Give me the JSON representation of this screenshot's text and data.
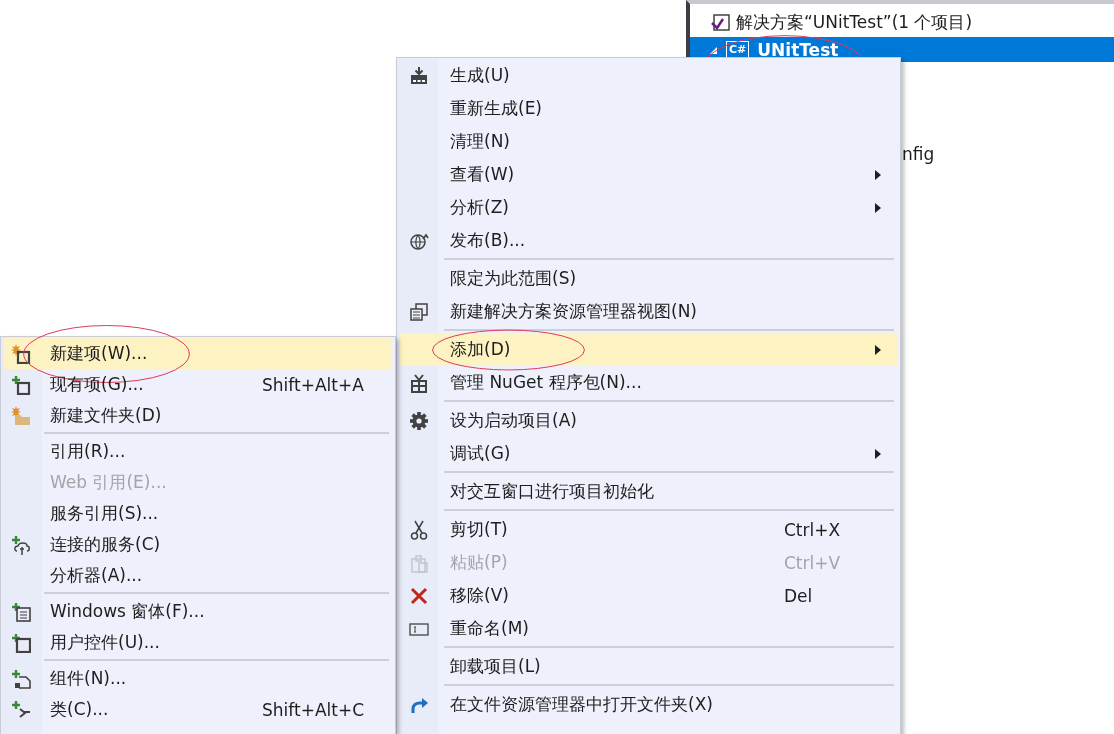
{
  "solution_explorer": {
    "solution": {
      "label": "解决方案“UNitTest”(1 个项目)"
    },
    "project": {
      "label": "UNitTest",
      "icon_text": "C#",
      "selected": true,
      "expanded": true,
      "circled": true
    },
    "hidden_item": {
      "label": "nfig"
    }
  },
  "context_menu": {
    "groups": [
      [
        {
          "label": "生成(U)",
          "selected": false,
          "disabled": false,
          "submenu": false,
          "circled": false
        },
        {
          "label": "重新生成(E)",
          "selected": false,
          "disabled": false,
          "submenu": false,
          "circled": false
        },
        {
          "label": "清理(N)",
          "selected": false,
          "disabled": false,
          "submenu": false,
          "circled": false
        },
        {
          "label": "查看(W)",
          "selected": false,
          "disabled": false,
          "submenu": true,
          "circled": false
        },
        {
          "label": "分析(Z)",
          "selected": false,
          "disabled": false,
          "submenu": true,
          "circled": false
        },
        {
          "label": "发布(B)...",
          "selected": false,
          "disabled": false,
          "submenu": false,
          "circled": false
        }
      ],
      [
        {
          "label": "限定为此范围(S)",
          "selected": false,
          "disabled": false,
          "submenu": false,
          "circled": false
        },
        {
          "label": "新建解决方案资源管理器视图(N)",
          "selected": false,
          "disabled": false,
          "submenu": false,
          "circled": false
        }
      ],
      [
        {
          "label": "添加(D)",
          "selected": true,
          "disabled": false,
          "submenu": true,
          "circled": true
        },
        {
          "label": "管理 NuGet 程序包(N)...",
          "selected": false,
          "disabled": false,
          "submenu": false,
          "circled": false
        }
      ],
      [
        {
          "label": "设为启动项目(A)",
          "selected": false,
          "disabled": false,
          "submenu": false,
          "circled": false
        },
        {
          "label": "调试(G)",
          "selected": false,
          "disabled": false,
          "submenu": true,
          "circled": false
        }
      ],
      [
        {
          "label": "对交互窗口进行项目初始化",
          "selected": false,
          "disabled": false,
          "submenu": false,
          "circled": false
        }
      ],
      [
        {
          "label": "剪切(T)",
          "shortcut": "Ctrl+X",
          "selected": false,
          "disabled": false,
          "submenu": false,
          "circled": false
        },
        {
          "label": "粘贴(P)",
          "shortcut": "Ctrl+V",
          "selected": false,
          "disabled": true,
          "submenu": false,
          "circled": false
        },
        {
          "label": "移除(V)",
          "shortcut": "Del",
          "selected": false,
          "disabled": false,
          "submenu": false,
          "circled": false
        },
        {
          "label": "重命名(M)",
          "selected": false,
          "disabled": false,
          "submenu": false,
          "circled": false
        }
      ],
      [
        {
          "label": "卸载项目(L)",
          "selected": false,
          "disabled": false,
          "submenu": false,
          "circled": false
        }
      ],
      [
        {
          "label": "在文件资源管理器中打开文件夹(X)",
          "selected": false,
          "disabled": false,
          "submenu": false,
          "circled": false
        }
      ]
    ]
  },
  "add_submenu": {
    "groups": [
      [
        {
          "label": "新建项(W)...",
          "selected": true,
          "disabled": false,
          "submenu": false,
          "circled": true
        },
        {
          "label": "现有项(G)...",
          "shortcut": "Shift+Alt+A",
          "selected": false,
          "disabled": false,
          "submenu": false,
          "circled": false
        },
        {
          "label": "新建文件夹(D)",
          "selected": false,
          "disabled": false,
          "submenu": false,
          "circled": false
        }
      ],
      [
        {
          "label": "引用(R)...",
          "selected": false,
          "disabled": false,
          "submenu": false,
          "circled": false
        },
        {
          "label": "Web 引用(E)...",
          "selected": false,
          "disabled": true,
          "submenu": false,
          "circled": false
        },
        {
          "label": "服务引用(S)...",
          "selected": false,
          "disabled": false,
          "submenu": false,
          "circled": false
        },
        {
          "label": "连接的服务(C)",
          "selected": false,
          "disabled": false,
          "submenu": false,
          "circled": false
        },
        {
          "label": "分析器(A)...",
          "selected": false,
          "disabled": false,
          "submenu": false,
          "circled": false
        }
      ],
      [
        {
          "label": "Windows 窗体(F)...",
          "selected": false,
          "disabled": false,
          "submenu": false,
          "circled": false
        },
        {
          "label": "用户控件(U)...",
          "selected": false,
          "disabled": false,
          "submenu": false,
          "circled": false
        }
      ],
      [
        {
          "label": "组件(N)...",
          "selected": false,
          "disabled": false,
          "submenu": false,
          "circled": false
        },
        {
          "label": "类(C)...",
          "shortcut": "Shift+Alt+C",
          "selected": false,
          "disabled": false,
          "submenu": false,
          "circled": false
        }
      ]
    ]
  }
}
